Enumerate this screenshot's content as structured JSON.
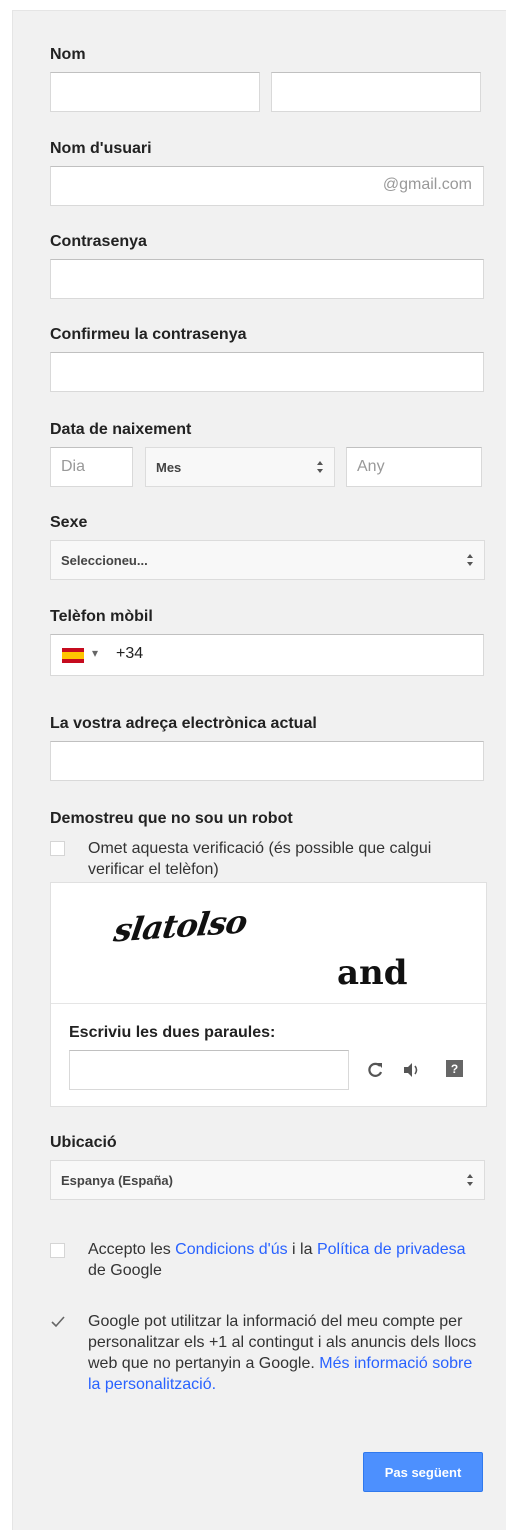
{
  "form": {
    "name_label": "Nom",
    "username_label": "Nom d'usuari",
    "username_suffix": "@gmail.com",
    "password_label": "Contrasenya",
    "confirm_label": "Confirmeu la contrasenya",
    "birth_label": "Data de naixement",
    "day_placeholder": "Dia",
    "month_value": "Mes",
    "year_placeholder": "Any",
    "gender_label": "Sexe",
    "gender_value": "Seleccioneu...",
    "phone_label": "Telèfon mòbil",
    "phone_code": "+34",
    "phone_dropdown": "▾",
    "email_label": "La vostra adreça electrònica actual",
    "robot_label": "Demostreu que no sou un robot",
    "skip_verification": "Omet aquesta verificació (és possible que calgui verificar el telèfon)",
    "captcha_word1": "slatolso",
    "captcha_word2": "and",
    "captcha_prompt": "Escriviu les dues paraules:",
    "location_label": "Ubicació",
    "location_value": "Espanya (España)",
    "terms_pre": "Accepto les ",
    "terms_link": "Condicions d'ús",
    "terms_mid": " i la ",
    "privacy_link": "Política de privadesa",
    "terms_post": " de Google",
    "personalize_text": "Google pot utilitzar la informació del meu compte per personalitzar els +1 al contingut i als anuncis dels llocs web que no pertanyin a Google. ",
    "personalize_link": "Més informació sobre la personalització.",
    "next_button": "Pas següent",
    "help_icon_label": "?"
  },
  "colors": {
    "accent": "#4d90fe",
    "link": "#2962ff",
    "panel_bg": "#f1f1f1"
  },
  "icons": [
    "refresh-icon",
    "audio-icon",
    "help-icon",
    "spain-flag-icon",
    "select-arrows-icon",
    "checkmark-icon"
  ]
}
